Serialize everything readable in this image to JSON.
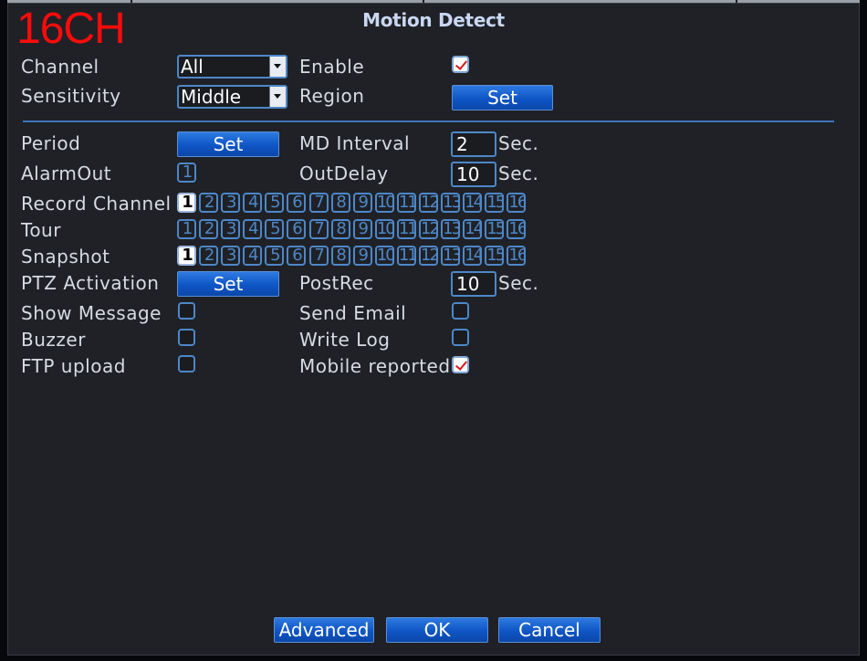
{
  "badge": "16CH",
  "title": "Motion Detect",
  "row1": {
    "label": "Channel",
    "value": "All",
    "enable_label": "Enable",
    "enable_checked": true
  },
  "row2": {
    "label": "Sensitivity",
    "value": "Middle",
    "region_label": "Region",
    "region_button": "Set"
  },
  "period": {
    "label": "Period",
    "button": "Set",
    "md_label": "MD Interval",
    "md_value": "2",
    "md_unit": "Sec."
  },
  "alarm": {
    "label": "AlarmOut",
    "box": "1",
    "delay_label": "OutDelay",
    "delay_value": "10",
    "delay_unit": "Sec."
  },
  "channels": [
    "1",
    "2",
    "3",
    "4",
    "5",
    "6",
    "7",
    "8",
    "9",
    "10",
    "11",
    "12",
    "13",
    "14",
    "15",
    "16"
  ],
  "record": {
    "label": "Record Channel",
    "active": [
      "1"
    ]
  },
  "tour": {
    "label": "Tour",
    "active": []
  },
  "snapshot": {
    "label": "Snapshot",
    "active": [
      "1"
    ]
  },
  "ptz": {
    "label": "PTZ Activation",
    "button": "Set",
    "post_label": "PostRec",
    "post_value": "10",
    "post_unit": "Sec."
  },
  "show_message": {
    "label": "Show Message",
    "checked": false
  },
  "send_email": {
    "label": "Send Email",
    "checked": false
  },
  "buzzer": {
    "label": "Buzzer",
    "checked": false
  },
  "write_log": {
    "label": "Write Log",
    "checked": false
  },
  "ftp": {
    "label": "FTP upload",
    "checked": false
  },
  "mobile": {
    "label": "Mobile reported",
    "checked": true
  },
  "footer": {
    "advanced": "Advanced",
    "ok": "OK",
    "cancel": "Cancel"
  },
  "colors": {
    "accent": "#0f55c6",
    "border": "#4d87c8",
    "badge": "#ff0a0a"
  }
}
